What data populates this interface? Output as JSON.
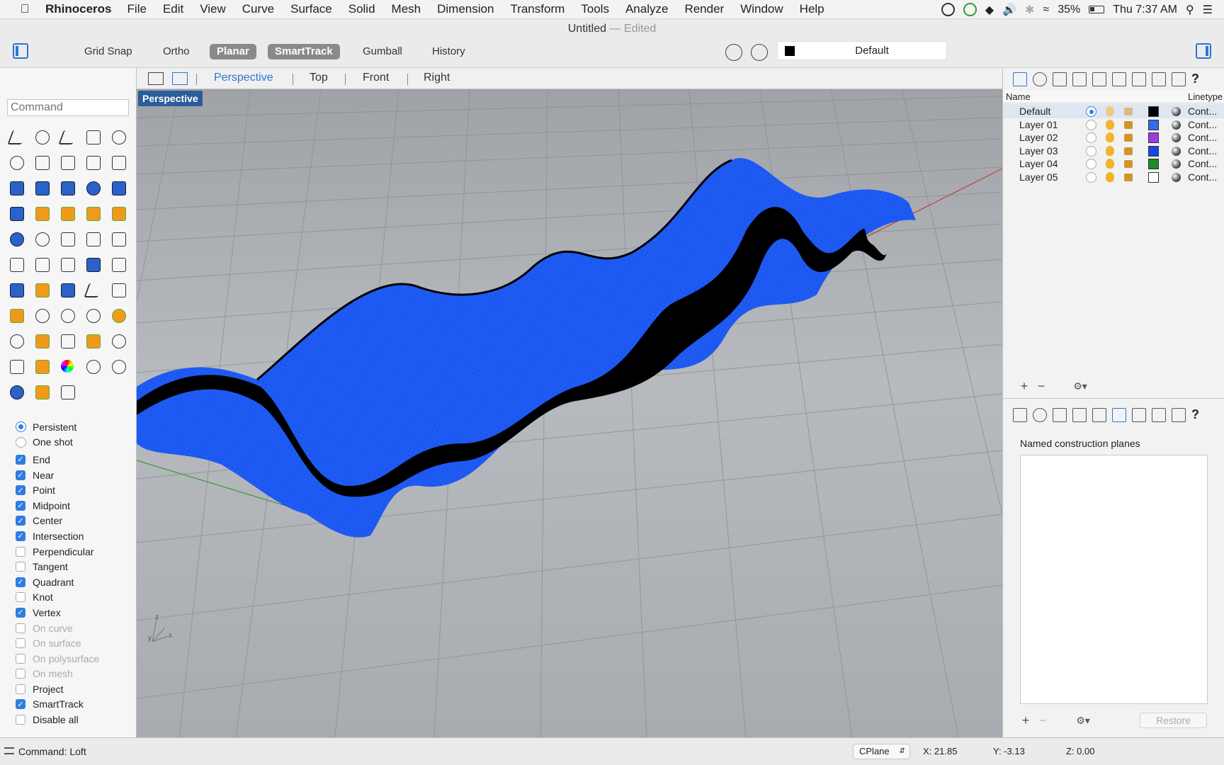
{
  "menubar": {
    "app": "Rhinoceros",
    "items": [
      "File",
      "Edit",
      "View",
      "Curve",
      "Surface",
      "Solid",
      "Mesh",
      "Dimension",
      "Transform",
      "Tools",
      "Analyze",
      "Render",
      "Window",
      "Help"
    ],
    "battery": "35%",
    "clock": "Thu 7:37 AM"
  },
  "window": {
    "title": "Untitled",
    "edited": "Edited",
    "separator": "—"
  },
  "toolbar": {
    "buttons": [
      {
        "label": "Grid Snap",
        "active": false
      },
      {
        "label": "Ortho",
        "active": false
      },
      {
        "label": "Planar",
        "active": true
      },
      {
        "label": "SmartTrack",
        "active": true
      },
      {
        "label": "Gumball",
        "active": false
      },
      {
        "label": "History",
        "active": false
      }
    ],
    "layer": "Default",
    "layer_color": "#000000"
  },
  "command": {
    "placeholder": "Command",
    "status_label": "Command: Loft"
  },
  "snaps": {
    "mode": [
      {
        "label": "Persistent",
        "selected": true
      },
      {
        "label": "One shot",
        "selected": false
      }
    ],
    "items": [
      {
        "label": "End",
        "checked": true,
        "enabled": true
      },
      {
        "label": "Near",
        "checked": true,
        "enabled": true
      },
      {
        "label": "Point",
        "checked": true,
        "enabled": true
      },
      {
        "label": "Midpoint",
        "checked": true,
        "enabled": true
      },
      {
        "label": "Center",
        "checked": true,
        "enabled": true
      },
      {
        "label": "Intersection",
        "checked": true,
        "enabled": true
      },
      {
        "label": "Perpendicular",
        "checked": false,
        "enabled": true
      },
      {
        "label": "Tangent",
        "checked": false,
        "enabled": true
      },
      {
        "label": "Quadrant",
        "checked": true,
        "enabled": true
      },
      {
        "label": "Knot",
        "checked": false,
        "enabled": true
      },
      {
        "label": "Vertex",
        "checked": true,
        "enabled": true
      },
      {
        "label": "On curve",
        "checked": false,
        "enabled": false
      },
      {
        "label": "On surface",
        "checked": false,
        "enabled": false
      },
      {
        "label": "On polysurface",
        "checked": false,
        "enabled": false
      },
      {
        "label": "On mesh",
        "checked": false,
        "enabled": false
      },
      {
        "label": "Project",
        "checked": false,
        "enabled": true
      },
      {
        "label": "SmartTrack",
        "checked": true,
        "enabled": true
      },
      {
        "label": "Disable all",
        "checked": false,
        "enabled": true
      }
    ]
  },
  "viewport": {
    "tabs": [
      "Perspective",
      "Top",
      "Front",
      "Right"
    ],
    "active_tab": "Perspective",
    "label": "Perspective",
    "axes": {
      "x": "x",
      "y": "y",
      "z": "z"
    },
    "surface_color": "#1f5cf5"
  },
  "layers": {
    "header": {
      "name": "Name",
      "linetype": "Linetype"
    },
    "rows": [
      {
        "name": "Default",
        "current": true,
        "color": "#000000",
        "linetype": "Cont..."
      },
      {
        "name": "Layer 01",
        "current": false,
        "color": "#2f6ee8",
        "linetype": "Cont..."
      },
      {
        "name": "Layer 02",
        "current": false,
        "color": "#9b3be0",
        "linetype": "Cont..."
      },
      {
        "name": "Layer 03",
        "current": false,
        "color": "#1746e6",
        "linetype": "Cont..."
      },
      {
        "name": "Layer 04",
        "current": false,
        "color": "#1a8a2a",
        "linetype": "Cont..."
      },
      {
        "name": "Layer 05",
        "current": false,
        "color": "#ffffff",
        "linetype": "Cont..."
      }
    ]
  },
  "cplanes": {
    "title": "Named construction planes",
    "restore": "Restore"
  },
  "status": {
    "cplane": "CPlane",
    "x": "X: 21.85",
    "y": "Y: -3.13",
    "z": "Z: 0.00"
  }
}
